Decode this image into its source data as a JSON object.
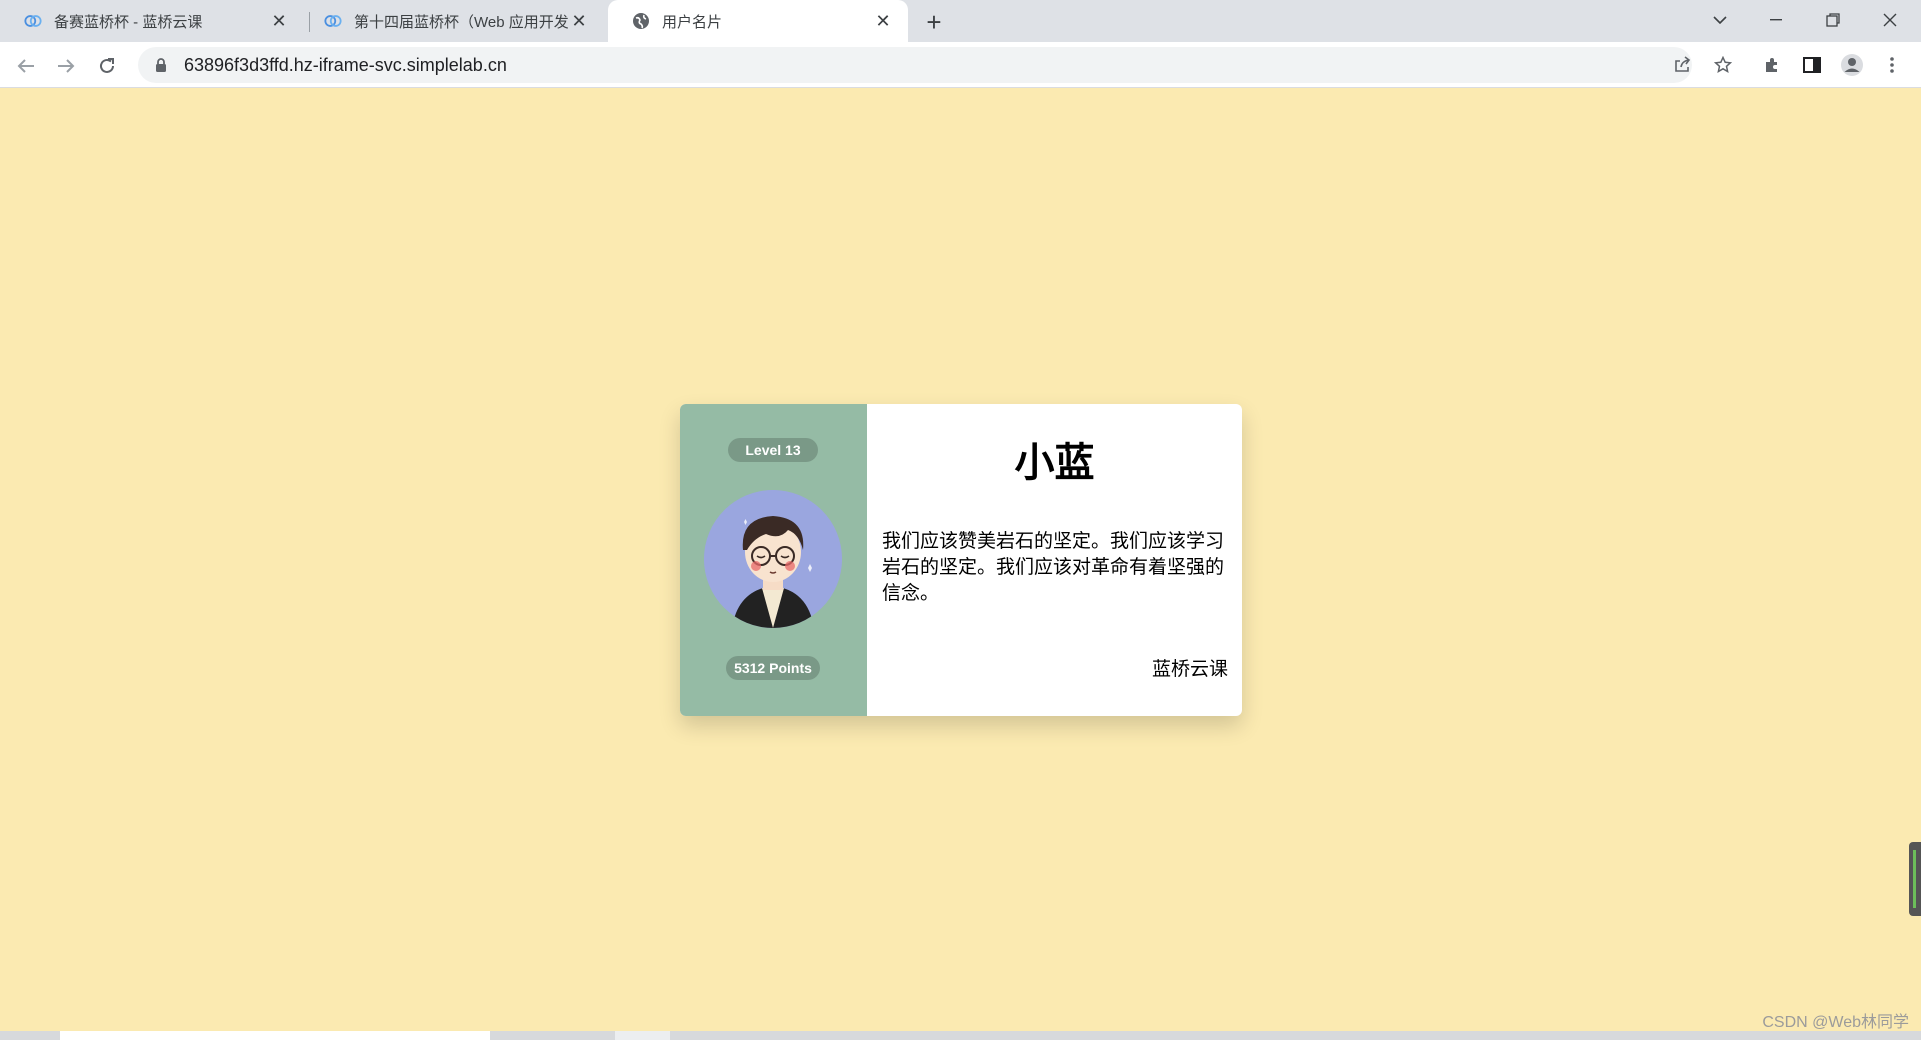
{
  "browser": {
    "tabs": [
      {
        "title": "备赛蓝桥杯 - 蓝桥云课",
        "icon": "lanqiao-cloud-icon",
        "active": false
      },
      {
        "title": "第十四届蓝桥杯（Web 应用开发",
        "icon": "lanqiao-cloud-icon",
        "active": false
      },
      {
        "title": "用户名片",
        "icon": "globe-icon",
        "active": true
      }
    ],
    "url": "63896f3d3ffd.hz-iframe-svc.simplelab.cn"
  },
  "card": {
    "level": "Level 13",
    "points": "5312 Points",
    "name": "小蓝",
    "bio": "我们应该赞美岩石的坚定。我们应该学习岩石的坚定。我们应该对革命有着坚强的信念。",
    "author": "蓝桥云课",
    "colors": {
      "left_panel": "#95bba5",
      "page_background": "#fbeab1",
      "avatar_background": "#9aa6df"
    }
  },
  "watermark": "CSDN @Web林同学"
}
